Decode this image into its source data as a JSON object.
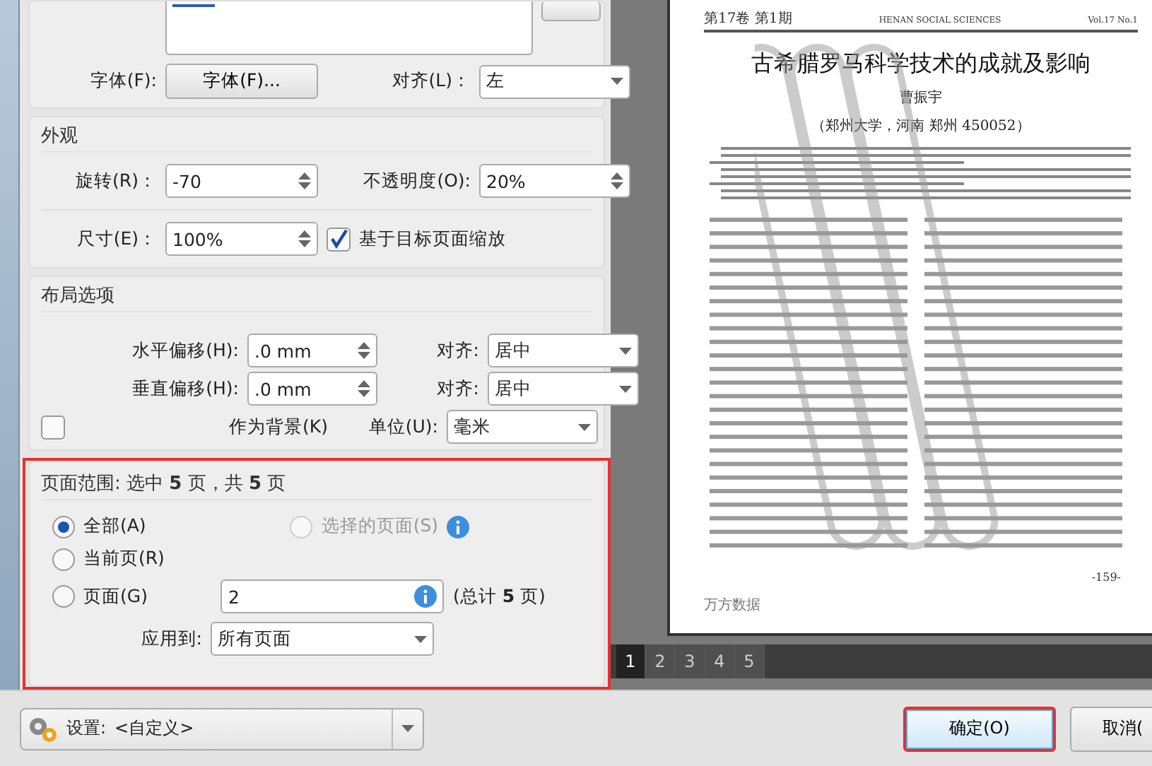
{
  "text_section": {
    "font_label": "字体(F):",
    "font_button": "字体(F)...",
    "align_label": "对齐(L)：",
    "align_value": "左"
  },
  "appearance": {
    "title": "外观",
    "rotation_label": "旋转(R)：",
    "rotation": "-70",
    "opacity_label": "不透明度(O):",
    "opacity": "20%",
    "size_label": "尺寸(E)：",
    "size": "100%",
    "scale_checkbox": {
      "label": "基于目标页面缩放",
      "checked": true
    }
  },
  "layout": {
    "title": "布局选项",
    "rows": [
      {
        "label": "水平偏移(H):",
        "value": ".0 mm",
        "align_label": "对齐:",
        "align_value": "居中"
      },
      {
        "label": "垂直偏移(H):",
        "value": ".0 mm",
        "align_label": "对齐:",
        "align_value": "居中"
      }
    ],
    "background_checkbox": {
      "label": "作为背景(K)",
      "checked": false
    },
    "unit_label": "单位(U):",
    "unit_value": "毫米"
  },
  "page_range": {
    "title": "页面范围: 选中 **5** 页，共 **5** 页",
    "options": [
      {
        "label": "全部(A)",
        "selected": true,
        "disabled": false
      },
      {
        "label": "选择的页面(S)",
        "selected": false,
        "disabled": true
      },
      {
        "label": "当前页(R)",
        "selected": false,
        "disabled": false
      },
      {
        "label": "页面(G)",
        "selected": false,
        "disabled": false
      }
    ],
    "pages_value": "2",
    "total": "(总计 **5** 页)",
    "apply_label": "应用到:",
    "apply_value": "所有页面"
  },
  "preview": {
    "header_left": "第17卷 第1期",
    "header_center": "HENAN SOCIAL SCIENCES",
    "header_right": "Vol.17 No.1",
    "title": "古希腊罗马科学技术的成就及影响",
    "author": "曹振宇",
    "affiliation": "（郑州大学，河南 郑州 450052）",
    "page_number": "-159-",
    "source": "万方数据"
  },
  "page_tabs": [
    {
      "label": "1",
      "selected": true
    },
    {
      "label": "2",
      "selected": false
    },
    {
      "label": "3",
      "selected": false
    },
    {
      "label": "4",
      "selected": false
    },
    {
      "label": "5",
      "selected": false
    }
  ],
  "footer": {
    "settings_label": "设置:",
    "settings_value": "<自定义>",
    "ok": "确定(O)",
    "cancel": "取消("
  }
}
